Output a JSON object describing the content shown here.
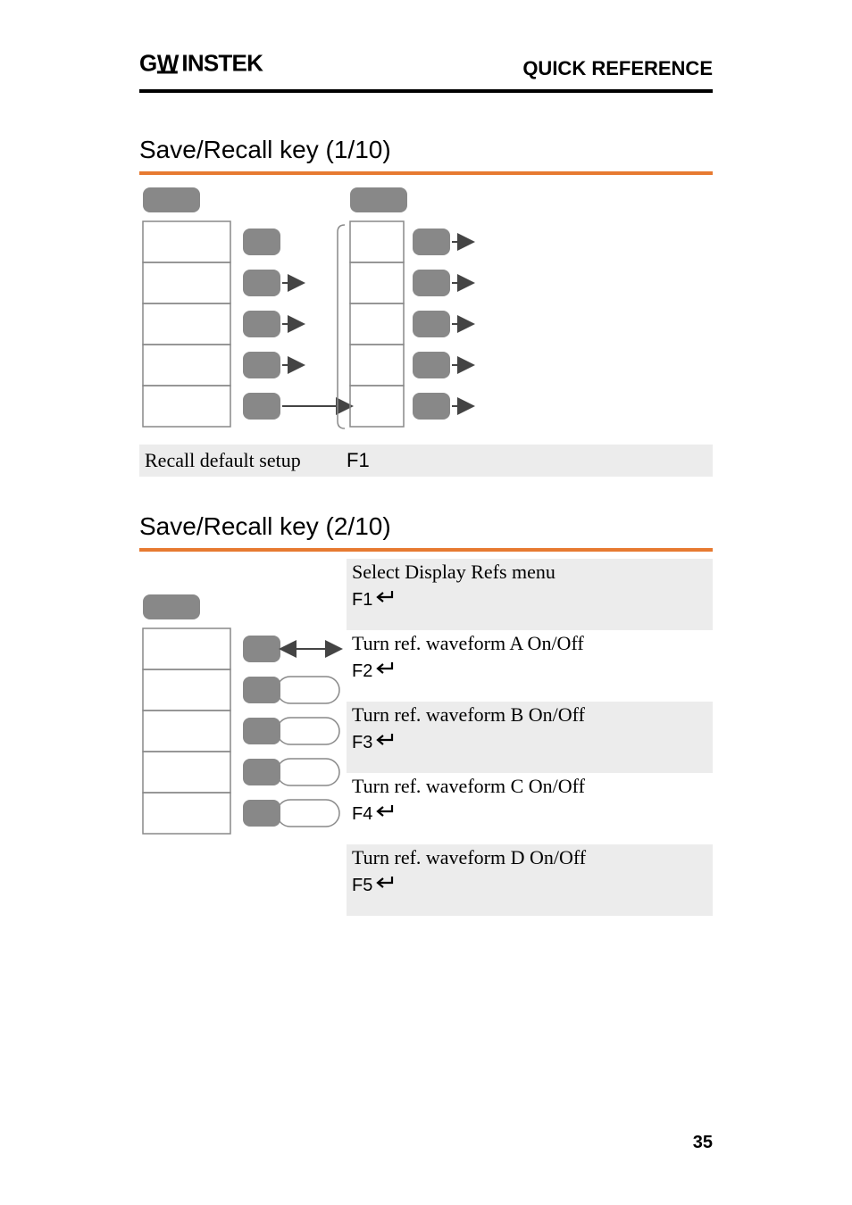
{
  "header": {
    "brand": "GWINSTEK",
    "section": "QUICK REFERENCE"
  },
  "section1": {
    "title": "Save/Recall key (1/10)",
    "action_label": "Recall default setup",
    "key_label": "F1"
  },
  "section2": {
    "title": "Save/Recall key (2/10)",
    "items": [
      {
        "text": "Select Display Refs menu",
        "key": "F1",
        "bg": true
      },
      {
        "text": "Turn ref. waveform A On/Off",
        "key": "F2",
        "bg": false
      },
      {
        "text": "Turn ref. waveform B On/Off",
        "key": "F3",
        "bg": true
      },
      {
        "text": "Turn ref. waveform C On/Off",
        "key": "F4",
        "bg": false
      },
      {
        "text": "Turn ref. waveform D On/Off",
        "key": "F5",
        "bg": true
      }
    ]
  },
  "page_number": "35"
}
